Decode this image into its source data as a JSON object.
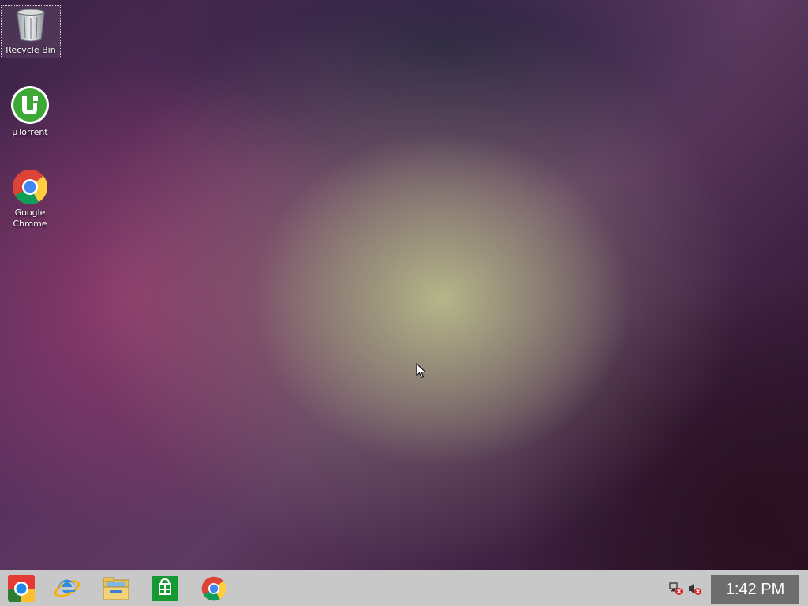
{
  "desktop": {
    "icons": [
      {
        "label": "Recycle Bin",
        "icon": "recycle-bin-icon"
      },
      {
        "label": "µTorrent",
        "icon": "utorrent-icon"
      },
      {
        "label": "Google Chrome",
        "icon": "chrome-icon"
      }
    ]
  },
  "taskbar": {
    "pinned": [
      {
        "name": "chrome-app-launcher",
        "icon": "chrome-launcher-icon"
      },
      {
        "name": "internet-explorer",
        "icon": "ie-icon"
      },
      {
        "name": "file-explorer",
        "icon": "folder-icon"
      },
      {
        "name": "windows-store",
        "icon": "store-icon"
      },
      {
        "name": "google-chrome",
        "icon": "chrome-icon"
      }
    ],
    "tray": {
      "network_icon": "network-disconnected-icon",
      "volume_icon": "volume-muted-icon",
      "clock": "1:42 PM"
    }
  },
  "colors": {
    "taskbar_bg": "#c9c8c8",
    "clock_bg": "#6d6d6d",
    "utorrent_green": "#3da836",
    "store_green": "#159a33"
  }
}
